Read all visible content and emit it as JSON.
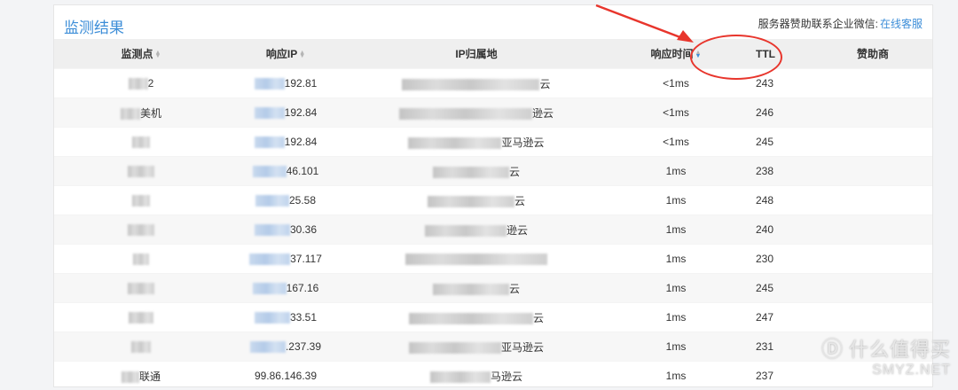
{
  "panel": {
    "title": "监测结果",
    "sponsor_text": "服务器赞助联系企业微信:",
    "sponsor_link": "在线客服"
  },
  "table": {
    "headers": [
      "监测点",
      "响应IP",
      "IP归属地",
      "响应时间",
      "TTL",
      "赞助商"
    ],
    "rows": [
      {
        "point": "2",
        "ip": "192.81",
        "location": "云",
        "time": "<1ms",
        "ttl": "243",
        "sponsor": ""
      },
      {
        "point": "美机",
        "ip": "192.84",
        "location": "逊云",
        "time": "<1ms",
        "ttl": "246",
        "sponsor": ""
      },
      {
        "point": "",
        "ip": "192.84",
        "location": "亚马逊云",
        "time": "<1ms",
        "ttl": "245",
        "sponsor": ""
      },
      {
        "point": "",
        "ip": "46.101",
        "location": "云",
        "time": "1ms",
        "ttl": "238",
        "sponsor": ""
      },
      {
        "point": "",
        "ip": "25.58",
        "location": "云",
        "time": "1ms",
        "ttl": "248",
        "sponsor": ""
      },
      {
        "point": "",
        "ip": "30.36",
        "location": "逊云",
        "time": "1ms",
        "ttl": "240",
        "sponsor": ""
      },
      {
        "point": "",
        "ip": "37.117",
        "location": "",
        "time": "1ms",
        "ttl": "230",
        "sponsor": ""
      },
      {
        "point": "",
        "ip": "167.16",
        "location": "云",
        "time": "1ms",
        "ttl": "245",
        "sponsor": ""
      },
      {
        "point": "",
        "ip": "33.51",
        "location": "云",
        "time": "1ms",
        "ttl": "247",
        "sponsor": ""
      },
      {
        "point": "",
        "ip": ".237.39",
        "location": "亚马逊云",
        "time": "1ms",
        "ttl": "231",
        "sponsor": ""
      },
      {
        "point": "联通",
        "ip": "99.86.146.39",
        "location": "马逊云",
        "time": "1ms",
        "ttl": "237",
        "sponsor": ""
      }
    ]
  },
  "annotation_color": "#e8352c",
  "accent_color": "#3d8ed8",
  "watermark": {
    "text": "什么值得买",
    "sub": "SMYZ.NET",
    "icon": "smzdm-logo-icon"
  }
}
